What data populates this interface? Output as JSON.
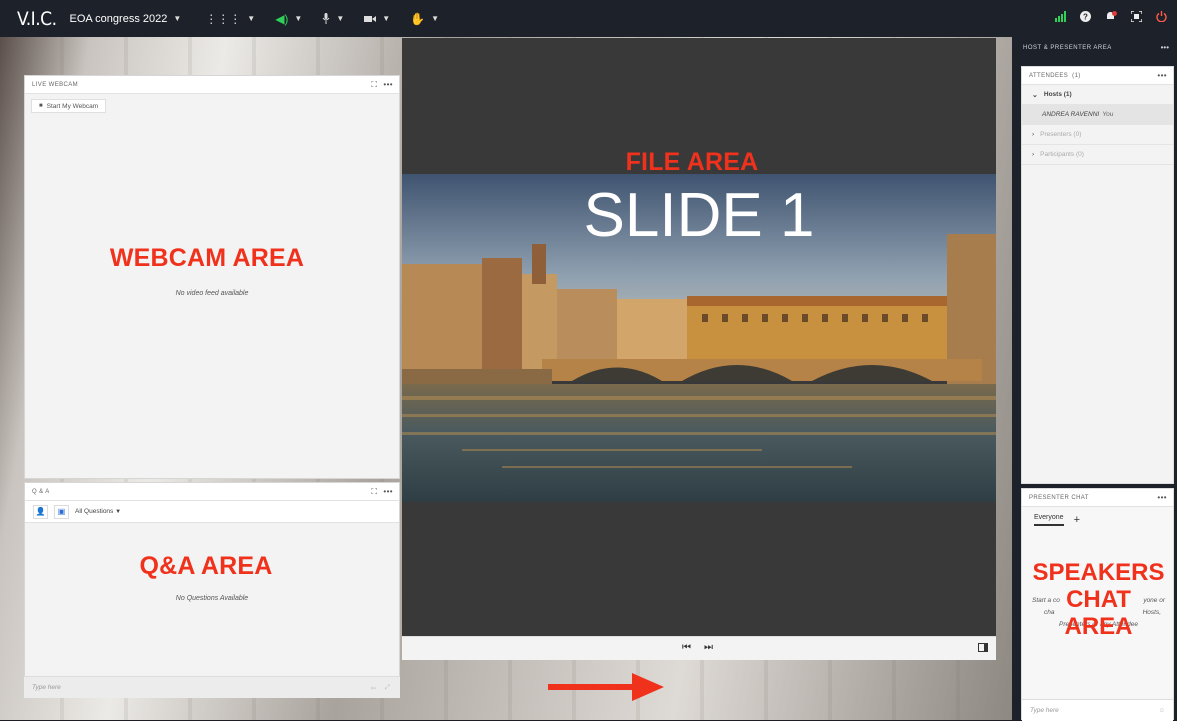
{
  "app": {
    "brand": "V.I.C.",
    "room_name": "EOA congress 2022"
  },
  "toolbar": {
    "icons": [
      "apps-icon",
      "speaker-icon",
      "microphone-icon",
      "camera-icon",
      "raise-hand-icon"
    ],
    "right_icons": [
      "signal-icon",
      "help-icon",
      "notifications-icon",
      "fullscreen-icon",
      "power-icon"
    ]
  },
  "webcam_pod": {
    "title": "LIVE WEBCAM",
    "start_button": "Start My Webcam",
    "status": "No video feed available",
    "overlay_label": "WEBCAM AREA"
  },
  "qa_pod": {
    "title": "Q & A",
    "filter": "All Questions",
    "status": "No Questions Available",
    "overlay_label": "Q&A AREA",
    "input_placeholder": "Type here"
  },
  "file_area": {
    "overlay_label": "FILE AREA",
    "slide_title": "SLIDE 1"
  },
  "right_panel": {
    "title": "HOST & PRESENTER AREA",
    "attendees": {
      "title": "ATTENDEES",
      "count": "(1)",
      "groups": [
        {
          "label": "Hosts (1)",
          "expanded": true
        },
        {
          "label": "Presenters (0)",
          "expanded": false
        },
        {
          "label": "Participants (0)",
          "expanded": false
        }
      ],
      "host_name": "ANDREA RAVENNI",
      "host_suffix": "You"
    },
    "chat": {
      "title": "PRESENTER CHAT",
      "tab": "Everyone",
      "add": "+",
      "hint_line1": "Start a co",
      "hint_line1b": "yone or",
      "hint_line2": "cha",
      "hint_line2b": "Hosts,",
      "hint_line3": "Presenters or any Attendee",
      "overlay_line1": "SPEAKERS",
      "overlay_line2": "CHAT",
      "overlay_line3": "AREA",
      "input_placeholder": "Type here"
    }
  },
  "colors": {
    "accent_red": "#f0311c",
    "topbar": "#1d2129",
    "file_bg": "#393939"
  }
}
